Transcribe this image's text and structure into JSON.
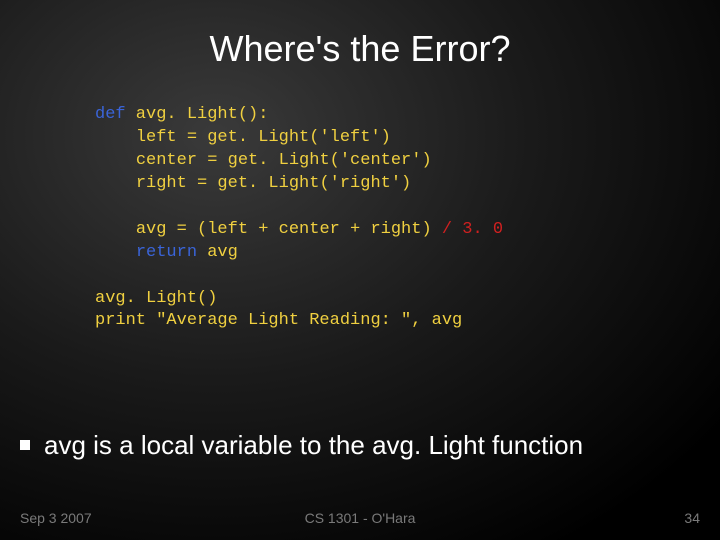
{
  "title": "Where's the Error?",
  "code": {
    "l1a": "def",
    "l1b": " avg. Light():",
    "indent": "    ",
    "l2": "left = get. Light('left')",
    "l3": "center = get. Light('center')",
    "l4": "right = get. Light('right')",
    "l5a": "avg = (left + center + right)",
    "l5b": " / 3. 0",
    "l6a": "return",
    "l6b": " avg",
    "l7": "avg. Light()",
    "l8": "print \"Average Light Reading: \", avg"
  },
  "bullet": "avg is a local variable to the avg. Light function",
  "footer": {
    "left": "Sep 3 2007",
    "center": "CS 1301 - O'Hara",
    "right": "34"
  }
}
